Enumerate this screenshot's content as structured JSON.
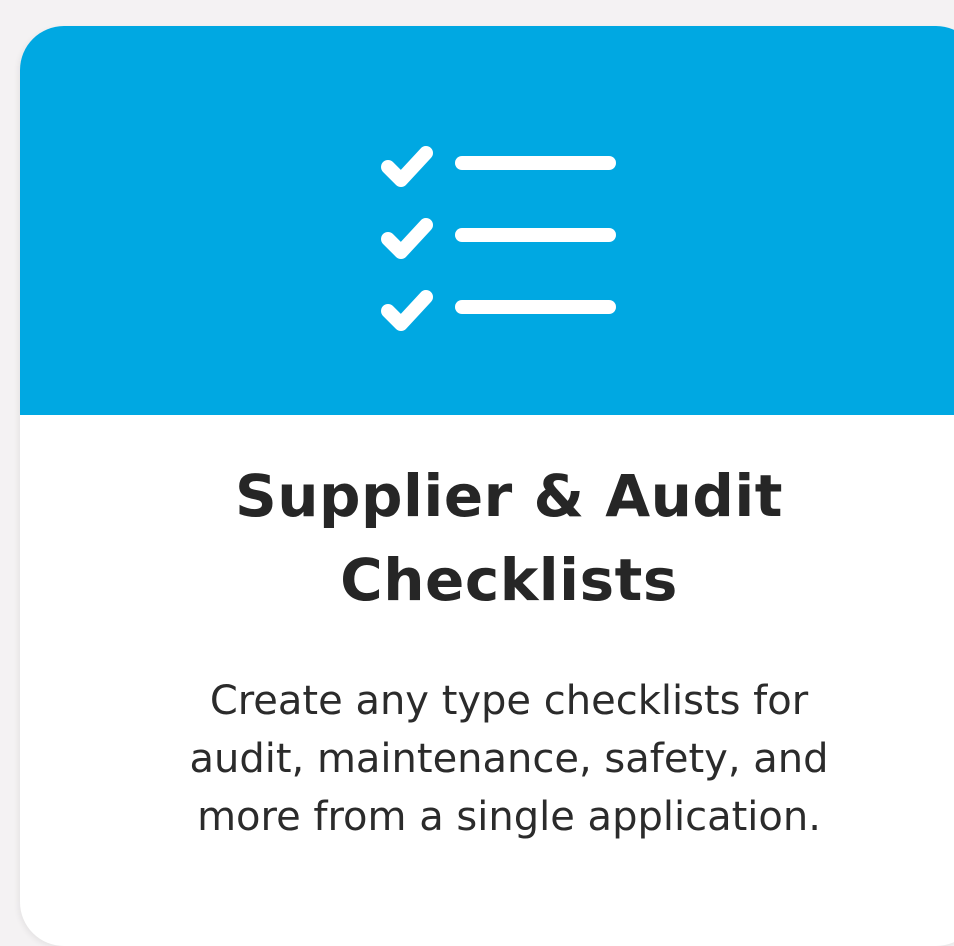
{
  "card": {
    "icon": "checklist-icon",
    "title_lines": [
      "Supplier & Audit",
      "Checklists"
    ],
    "description_lines": [
      "Create any type checklists for",
      "audit, maintenance, safety, and",
      "more from a single application."
    ]
  },
  "colors": {
    "header_background": "#00a8e2",
    "card_background": "#ffffff",
    "page_background": "#f4f2f3",
    "text": "#262626",
    "icon": "#ffffff"
  }
}
